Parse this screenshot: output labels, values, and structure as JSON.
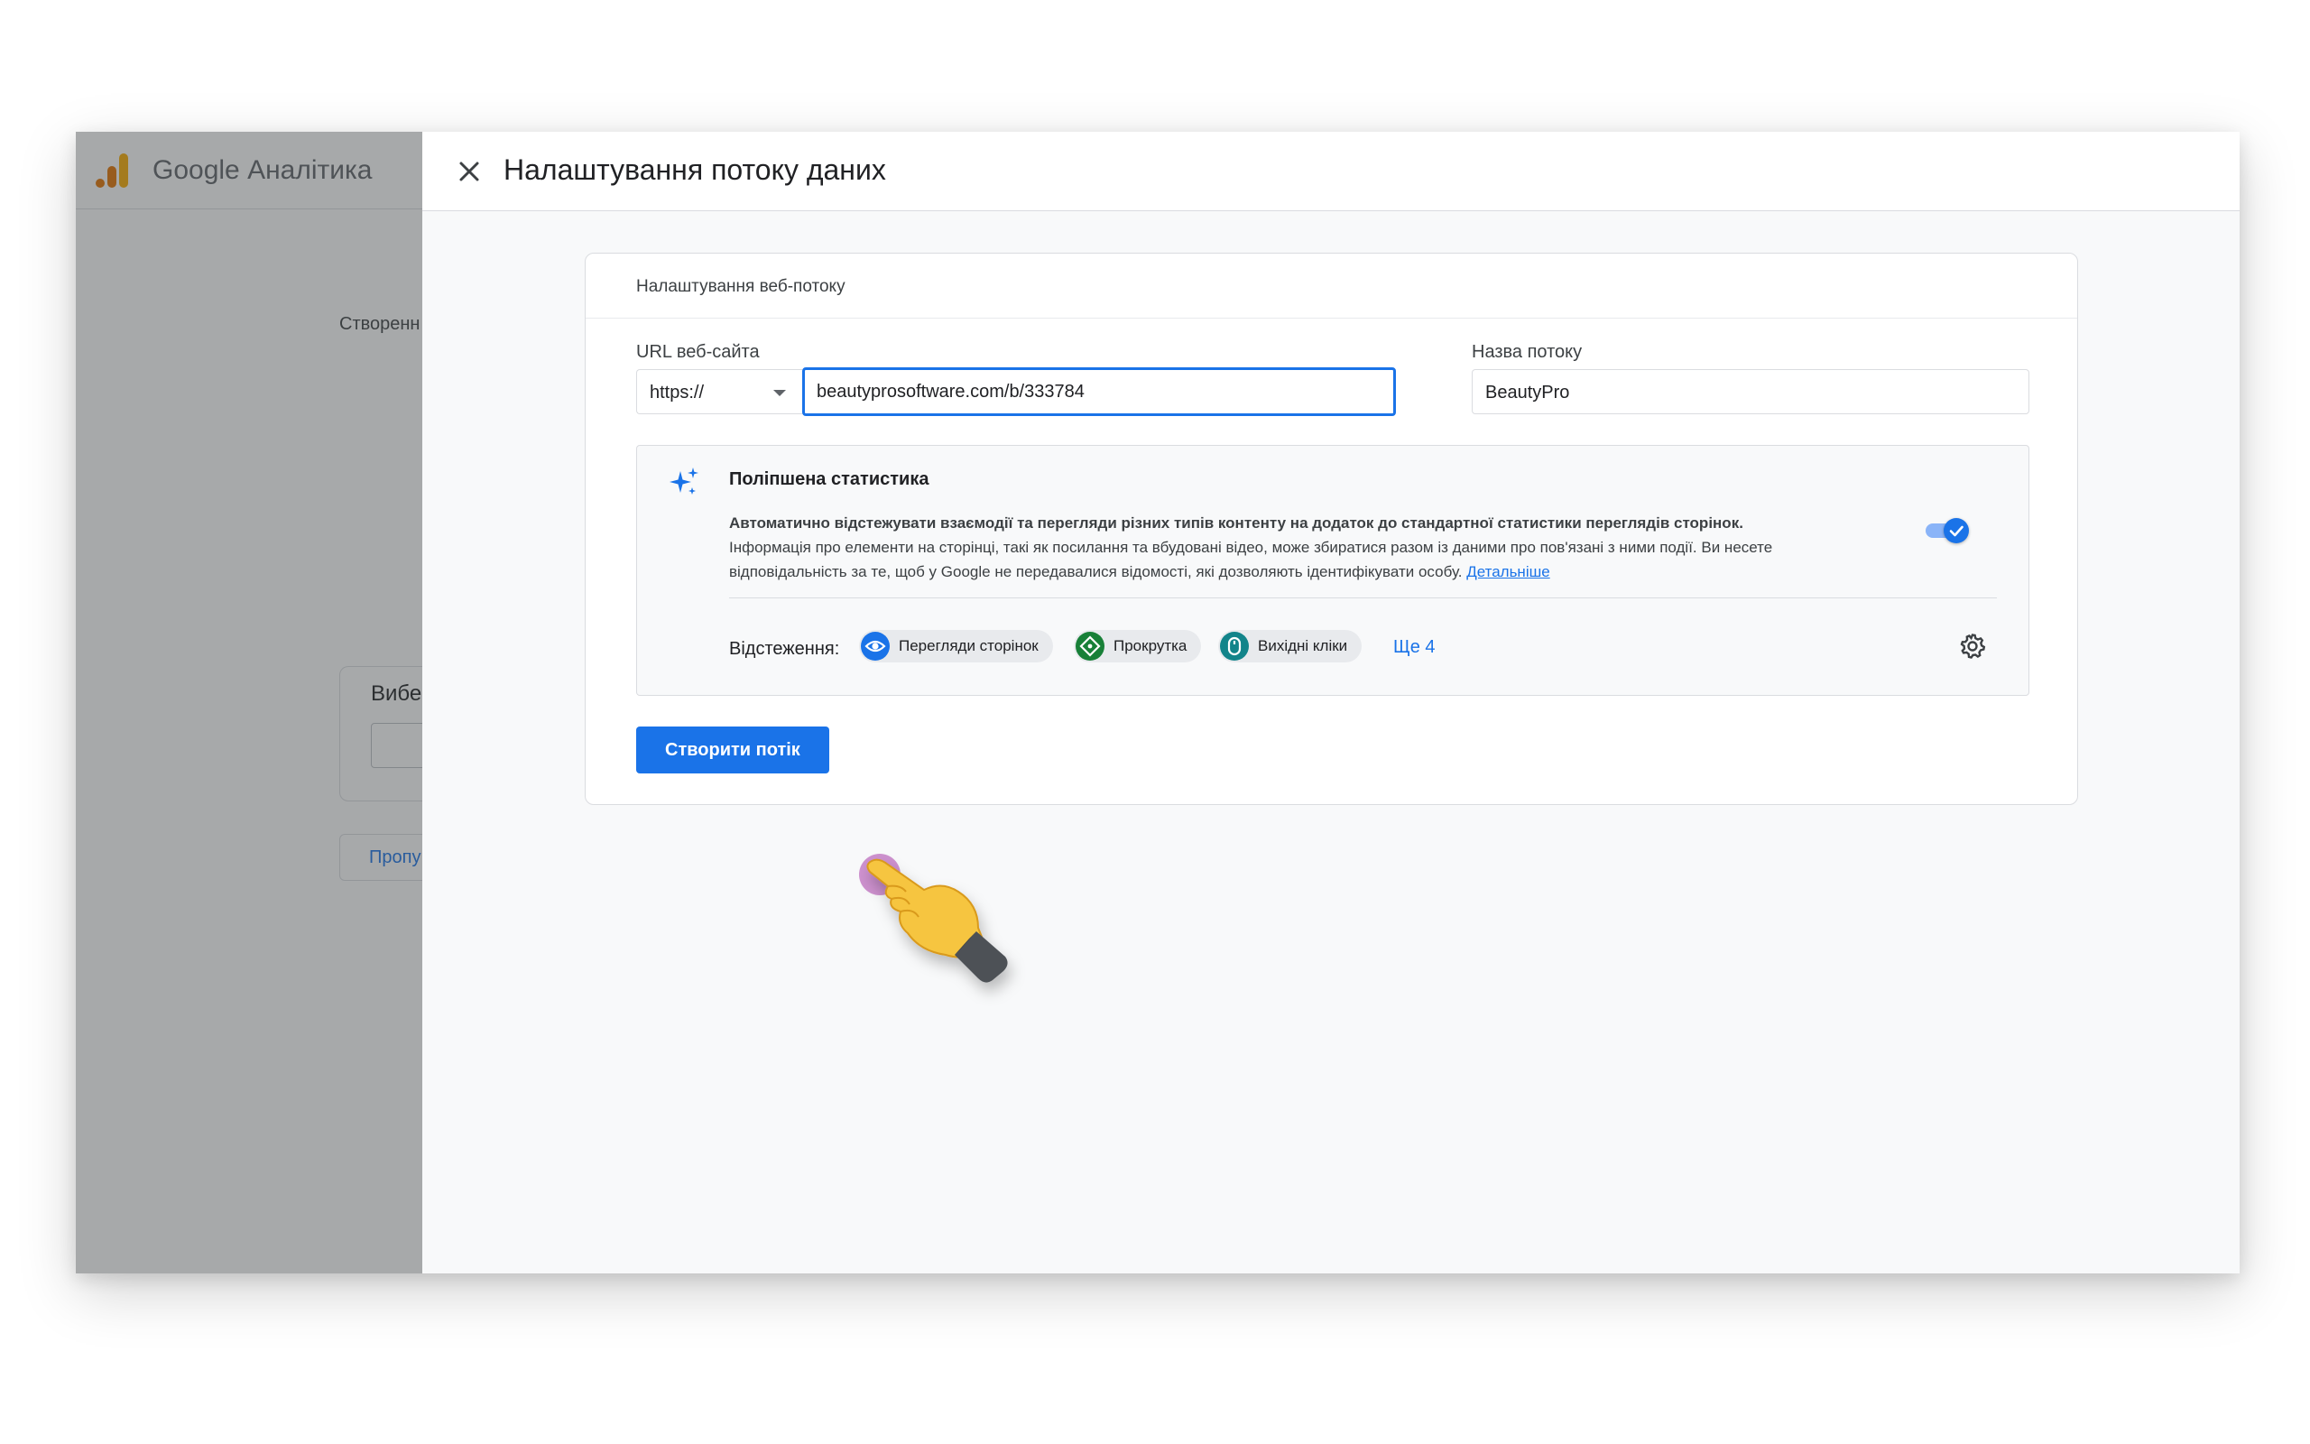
{
  "app": {
    "brand": "Google Аналітика",
    "logo_icon": "google-analytics-logo"
  },
  "background_page": {
    "text_fragment": "Створенн",
    "card_title_fragment": "Вибер",
    "button_fragment": "Пропу"
  },
  "dialog": {
    "title": "Налаштування потоку даних",
    "close_icon": "close-icon",
    "card": {
      "heading": "Налаштування веб-потоку",
      "url_label": "URL веб-сайта",
      "protocol_value": "https://",
      "url_value": "beautyprosoftware.com/b/333784",
      "stream_name_label": "Назва потоку",
      "stream_name_value": "BeautyPro",
      "enhanced": {
        "title": "Поліпшена статистика",
        "desc_bold": "Автоматично відстежувати взаємодії та перегляди різних типів контенту на додаток до стандартної статистики переглядів сторінок.",
        "desc_text": "Інформація про елементи на сторінці, такі як посилання та вбудовані відео, може збиратися разом із даними про пов'язані з ними події. Ви несете відповідальність за те, щоб у Google не передавалися відомості, які дозволяють ідентифікувати особу.",
        "learn_more": "Детальніше",
        "toggle_on": true,
        "tracking_label": "Відстеження:",
        "chips": [
          {
            "label": "Перегляди сторінок",
            "icon": "eye-icon",
            "color": "#1a73e8"
          },
          {
            "label": "Прокрутка",
            "icon": "scroll-arrows-icon",
            "color": "#188038"
          },
          {
            "label": "Вихідні кліки",
            "icon": "mouse-icon",
            "color": "#12848a"
          }
        ],
        "more": "Ще 4",
        "settings_icon": "gear-icon"
      },
      "create_button": "Створити потік"
    }
  },
  "colors": {
    "accent": "#1a73e8",
    "scrim": "#3c4043"
  }
}
